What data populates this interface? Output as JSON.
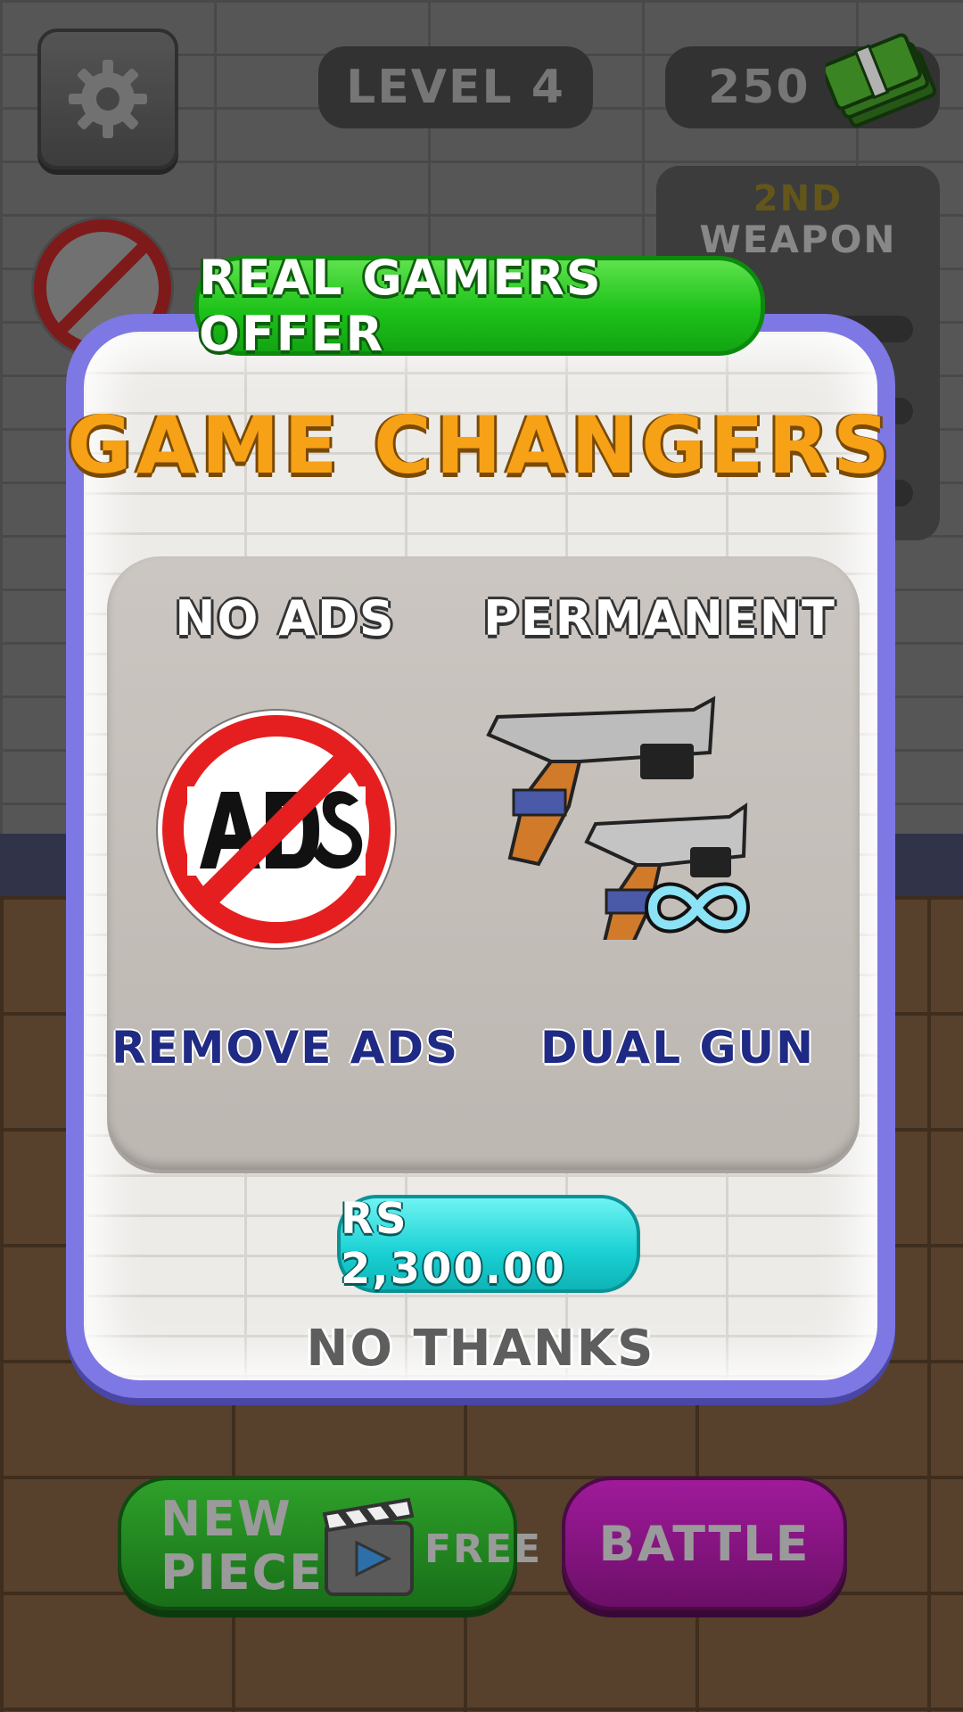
{
  "hud": {
    "level_label": "LEVEL 4",
    "cash_amount": "250",
    "weapon_card_line1": "2ND",
    "weapon_card_line2": "WEAPON"
  },
  "popup": {
    "banner": "REAL GAMERS OFFER",
    "title": "GAME CHANGERS",
    "offers": [
      {
        "header": "NO ADS",
        "footer": "REMOVE ADS",
        "icon": "no-ads-icon"
      },
      {
        "header": "PERMANENT",
        "footer": "DUAL GUN",
        "icon": "dual-pistol-icon",
        "badge": "infinity-icon"
      }
    ],
    "price_label": "RS 2,300.00",
    "decline_label": "NO THANKS"
  },
  "bottom_bar": {
    "new_piece_label": "NEW PIECE",
    "free_label": "FREE",
    "battle_label": "BATTLE"
  },
  "colors": {
    "panel_border": "#7d78e4",
    "banner_green": "#1ec21a",
    "title_orange": "#f7a117",
    "price_cyan": "#19d0d3",
    "offer_footer_blue": "#1f2a84"
  }
}
